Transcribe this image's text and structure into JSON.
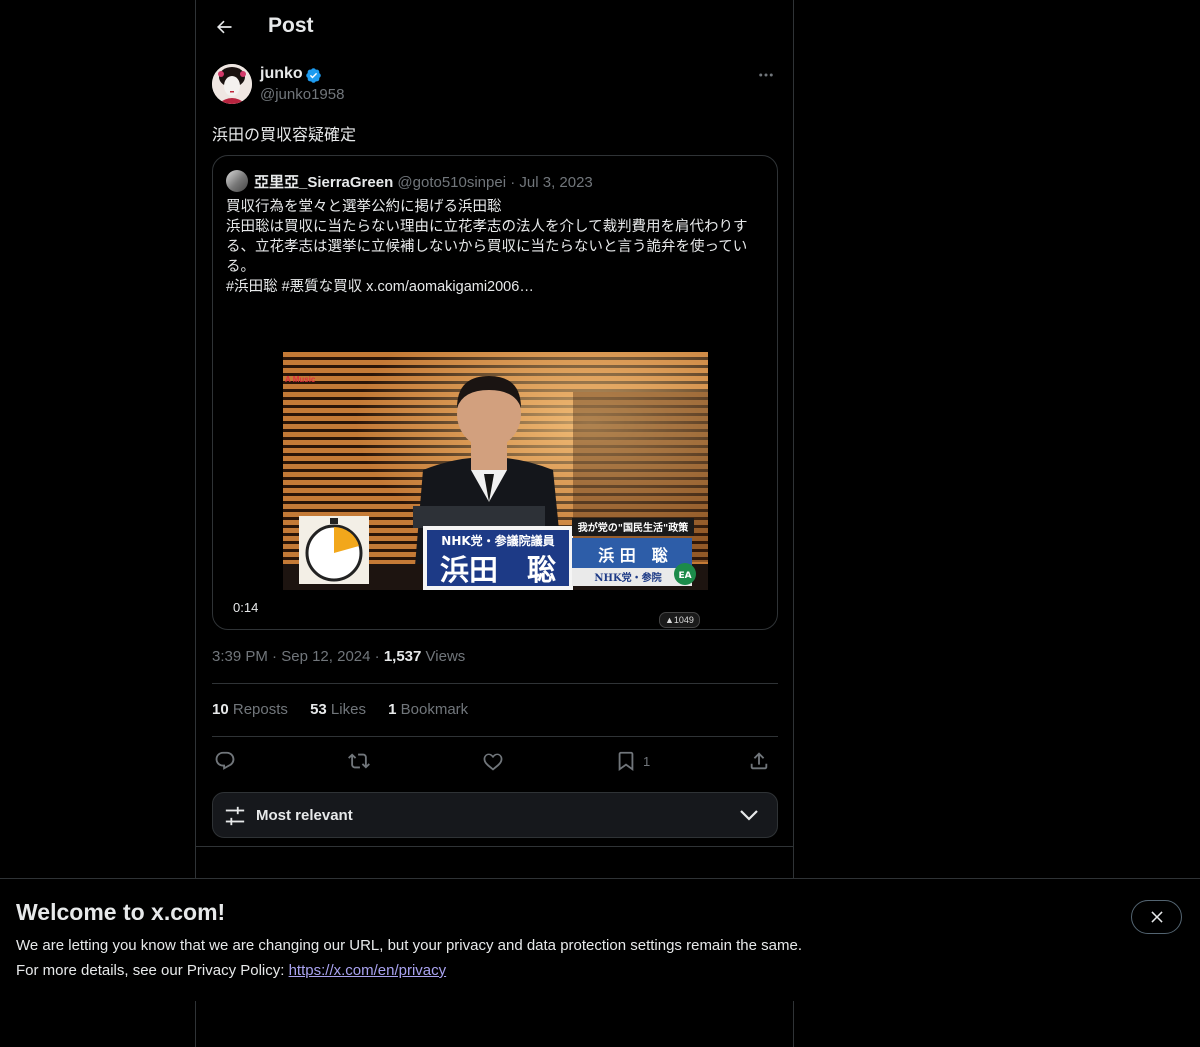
{
  "header": {
    "title": "Post"
  },
  "post": {
    "author_name": "junko",
    "author_handle": "@junko1958",
    "text": "浜田の買収容疑確定",
    "time": "3:39 PM",
    "date": "Sep 12, 2024",
    "views_count": "1,537",
    "views_label": "Views"
  },
  "quote": {
    "name": "亞里亞_SierraGreen",
    "handle": "@goto510sinpei",
    "dot": "·",
    "date": "Jul 3, 2023",
    "lines": [
      "買収行為を堂々と選挙公約に掲げる浜田聡",
      "浜田聡は買収に当たらない理由に立花孝志の法人を介して裁判費用を肩代わりする、立花孝志は選挙に立候補しないから買収に当たらないと言う詭弁を使っている。",
      "#浜田聡 #悪質な買収  x.com/aomakigami2006…"
    ],
    "video_duration": "0:14",
    "video_badge": "▲1049",
    "video_overlay": {
      "corner_label": "A Music",
      "nameplate_title": "NHK党・参議院議員",
      "nameplate_name": "浜田　聡",
      "side_title": "我が党の\"国民生活\"政策",
      "side_name": "浜 田　聡",
      "side_party": "NHK党・参院",
      "logo_text": "EA"
    }
  },
  "stats": {
    "reposts_count": "10",
    "reposts_label": "Reposts",
    "likes_count": "53",
    "likes_label": "Likes",
    "bookmarks_count": "1",
    "bookmarks_label": "Bookmark"
  },
  "actions": {
    "bookmark_count": "1",
    "icons": [
      "reply-icon",
      "repost-icon",
      "like-icon",
      "bookmark-icon",
      "share-icon"
    ]
  },
  "sort": {
    "label": "Most relevant"
  },
  "banner": {
    "title": "Welcome to x.com!",
    "line1": "We are letting you know that we are changing our URL, but your privacy and data protection settings remain the same.",
    "line2_prefix": "For more details, see our Privacy Policy: ",
    "link": "https://x.com/en/privacy"
  },
  "colors": {
    "background": "#000000",
    "text_primary": "#e7e9ea",
    "text_secondary": "#71767b",
    "border": "#2f3336",
    "verified_blue": "#1d9bf0",
    "link": "#a9a3f0"
  }
}
